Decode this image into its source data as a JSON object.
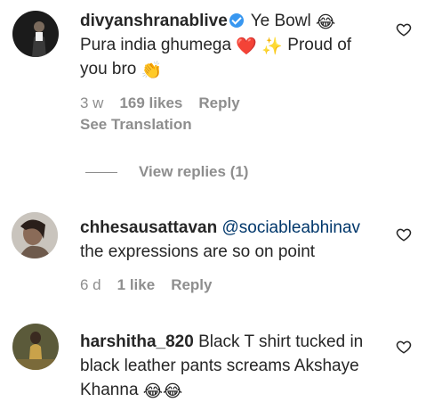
{
  "comments": [
    {
      "username": "divyanshranablive",
      "verified": true,
      "text_1": "Ye Bowl",
      "text_2": "Pura india ghumega",
      "text_3": "Proud of you bro",
      "emoji_1": "😂",
      "emoji_2": "❤️",
      "emoji_3": "✨",
      "emoji_4": "👏",
      "time": "3 w",
      "likes": "169 likes",
      "reply": "Reply",
      "see_translation": "See Translation",
      "view_replies": "View replies (1)"
    },
    {
      "username": "chhesausattavan",
      "mention": "@sociableabhinav",
      "text": "the expressions are so on point",
      "time": "6 d",
      "likes": "1 like",
      "reply": "Reply"
    },
    {
      "username": "harshitha_820",
      "text": "Black T shirt tucked in black leather pants screams Akshaye Khanna",
      "emoji_1": "😂",
      "emoji_2": "😂"
    }
  ],
  "icons": {
    "verified": "verified-badge-icon",
    "like": "heart-outline-icon"
  },
  "colors": {
    "text": "#262626",
    "secondary": "#8e8e8e",
    "mention": "#00376b",
    "verified": "#3897f0"
  }
}
